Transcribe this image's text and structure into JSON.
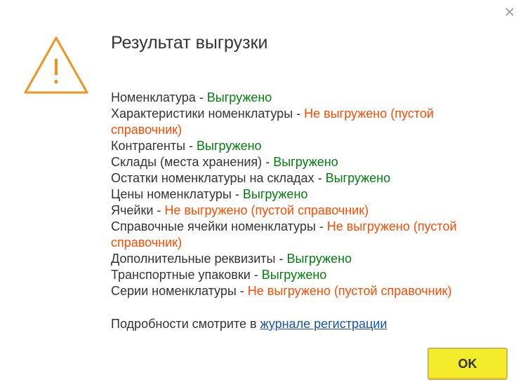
{
  "dialog": {
    "title": "Результат выгрузки",
    "close_icon": "close-icon",
    "warning_icon": "warning-triangle-icon"
  },
  "results": [
    {
      "name": "Номенклатура",
      "separator": " - ",
      "status": "Выгружено",
      "state": "ok"
    },
    {
      "name": "Характеристики номенклатуры",
      "separator": " - ",
      "status": "Не выгружено (пустой справочник)",
      "state": "error"
    },
    {
      "name": "Контрагенты",
      "separator": " - ",
      "status": "Выгружено",
      "state": "ok"
    },
    {
      "name": "Склады (места хранения)",
      "separator": " - ",
      "status": "Выгружено",
      "state": "ok"
    },
    {
      "name": "Остатки номенклатуры на складах",
      "separator": " - ",
      "status": "Выгружено",
      "state": "ok"
    },
    {
      "name": "Цены номенклатуры",
      "separator": " - ",
      "status": "Выгружено",
      "state": "ok"
    },
    {
      "name": "Ячейки",
      "separator": " - ",
      "status": "Не выгружено (пустой справочник)",
      "state": "error"
    },
    {
      "name": "Справочные ячейки номенклатуры",
      "separator": " - ",
      "status": "Не выгружено (пустой справочник)",
      "state": "error"
    },
    {
      "name": "Дополнительные реквизиты",
      "separator": " - ",
      "status": "Выгружено",
      "state": "ok"
    },
    {
      "name": "Транспортные упаковки",
      "separator": " - ",
      "status": "Выгружено",
      "state": "ok"
    },
    {
      "name": "Серии номенклатуры",
      "separator": " - ",
      "status": "Не выгружено (пустой справочник)",
      "state": "error"
    }
  ],
  "details": {
    "text": "Подробности смотрите в ",
    "link_text": "журнале регистрации"
  },
  "buttons": {
    "ok_label": "OK"
  },
  "colors": {
    "ok_status": "#00800a",
    "error_status": "#ff4b00",
    "warning_icon": "#f0931e",
    "ok_button": "#f3ec2a",
    "link": "#1a54a8"
  }
}
